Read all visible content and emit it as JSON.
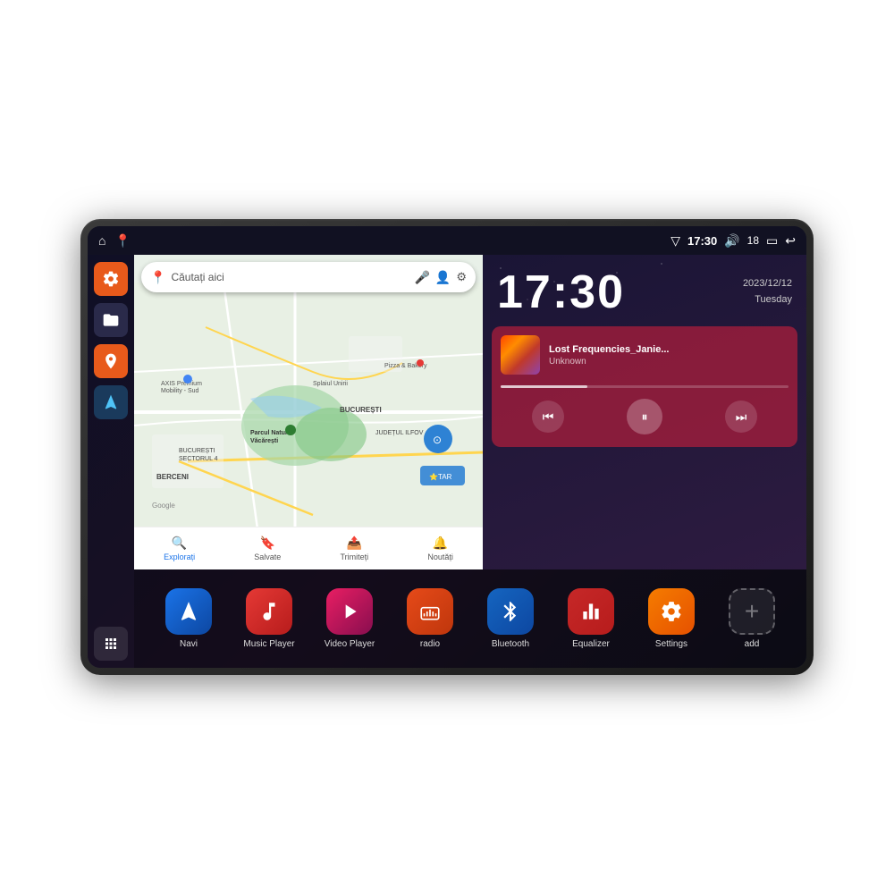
{
  "device": {
    "status_bar": {
      "wifi_icon": "▼",
      "time": "17:30",
      "volume_icon": "🔊",
      "battery_level": "18",
      "battery_icon": "🔋",
      "back_icon": "↩"
    },
    "sidebar": {
      "settings_icon": "⚙",
      "folder_icon": "📁",
      "map_icon": "📍",
      "nav_icon": "▲",
      "grid_icon": "⋮⋮"
    },
    "map": {
      "search_placeholder": "Căutați aici",
      "location_name1": "AXIS Premium Mobility - Sud",
      "location_name2": "Parcul Natural Văcărești",
      "location_name3": "Pizza & Bakery",
      "area1": "BUCURESTI SECTORUL 4",
      "area2": "BUCUREȘTI",
      "area3": "JUDEȚUL ILFOV",
      "area4": "BERCENI",
      "bottom_items": [
        {
          "icon": "📍",
          "label": "Explorați"
        },
        {
          "icon": "🔖",
          "label": "Salvate"
        },
        {
          "icon": "📤",
          "label": "Trimiteți"
        },
        {
          "icon": "🔔",
          "label": "Noutăți"
        }
      ]
    },
    "clock": {
      "time": "17:30",
      "date": "2023/12/12",
      "day": "Tuesday"
    },
    "music": {
      "title": "Lost Frequencies_Janie...",
      "artist": "Unknown",
      "progress": 30
    },
    "apps": [
      {
        "id": "navi",
        "label": "Navi",
        "class": "app-navi",
        "icon": "▲"
      },
      {
        "id": "music",
        "label": "Music Player",
        "class": "app-music",
        "icon": "🎵"
      },
      {
        "id": "video",
        "label": "Video Player",
        "class": "app-video",
        "icon": "▶"
      },
      {
        "id": "radio",
        "label": "radio",
        "class": "app-radio",
        "icon": "📻"
      },
      {
        "id": "bluetooth",
        "label": "Bluetooth",
        "class": "app-bluetooth",
        "icon": "⚡"
      },
      {
        "id": "equalizer",
        "label": "Equalizer",
        "class": "app-eq",
        "icon": "📊"
      },
      {
        "id": "settings",
        "label": "Settings",
        "class": "app-settings",
        "icon": "⚙"
      },
      {
        "id": "add",
        "label": "add",
        "class": "app-add",
        "icon": "+"
      }
    ]
  }
}
